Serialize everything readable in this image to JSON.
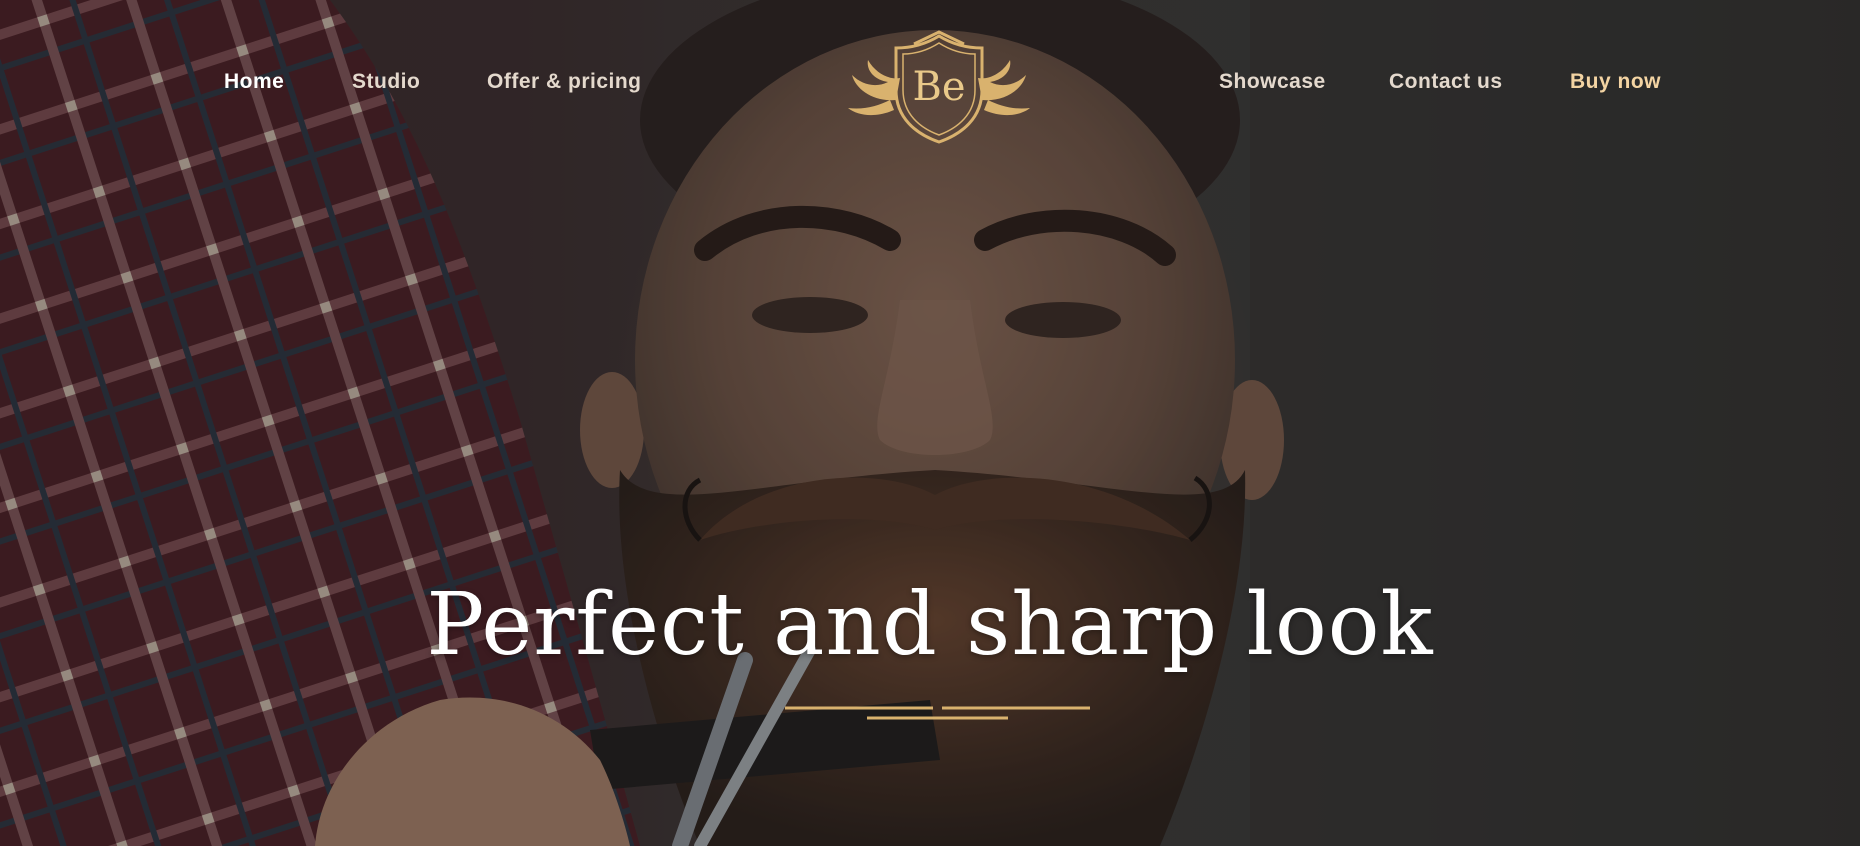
{
  "nav": {
    "home": "Home",
    "studio": "Studio",
    "offer": "Offer & pricing",
    "showcase": "Showcase",
    "contact": "Contact us",
    "buy": "Buy now"
  },
  "logo": {
    "text": "Be",
    "icon": "crest-shield-icon"
  },
  "hero": {
    "headline": "Perfect and sharp look",
    "background": "bearded-man-haircut-photo"
  },
  "colors": {
    "accent_gold": "#d9b26e",
    "buy_link": "#f3d4a3",
    "nav_text": "#e4d9cd",
    "headline": "#ffffff"
  }
}
